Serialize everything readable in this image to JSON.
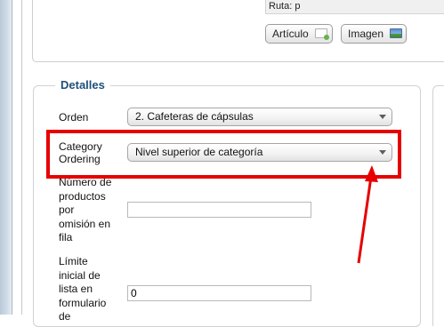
{
  "editor": {
    "ruta_text": "Ruta: p",
    "article_button": "Artículo",
    "image_button": "Imagen"
  },
  "details": {
    "legend": "Detalles",
    "orden": {
      "label": "Orden",
      "value": "2. Cafeteras de cápsulas"
    },
    "category_ordering": {
      "label_line1": "Category",
      "label_line2": "Ordering",
      "value": "Nivel superior de categoría"
    },
    "productos_por_fila": {
      "label_lines": [
        "Número de",
        "productos",
        "por",
        "omisión en",
        "fila"
      ],
      "value": ""
    },
    "limite_inicial": {
      "label_lines": [
        "Límite",
        "inicial de",
        "lista en",
        "formulario",
        "de"
      ],
      "value": "0"
    }
  },
  "annotation": {
    "color": "#e60000"
  }
}
